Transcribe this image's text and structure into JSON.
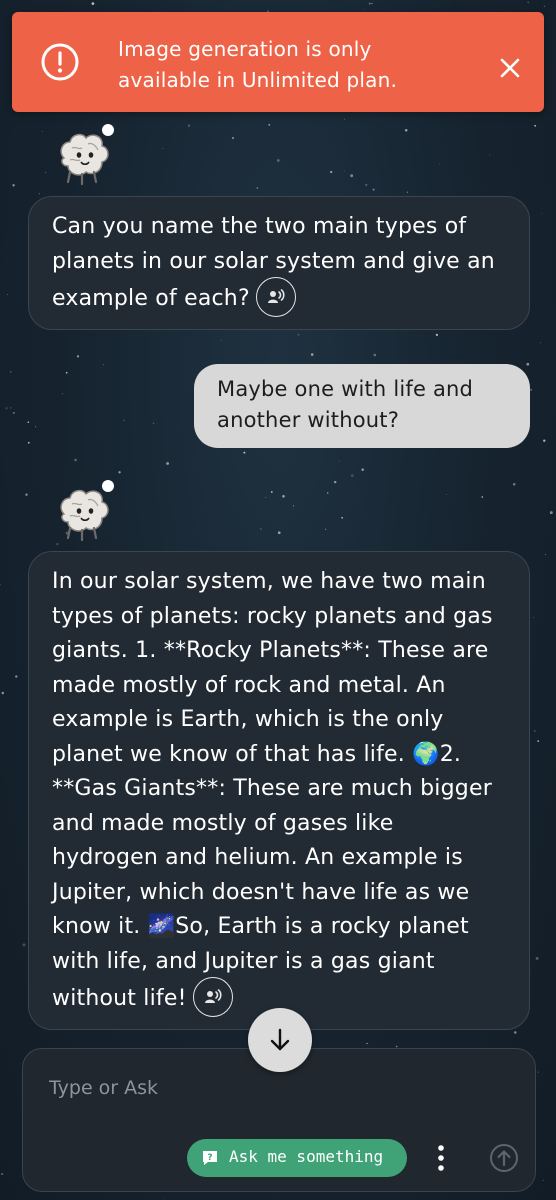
{
  "toast": {
    "icon": "alert-circle-icon",
    "line1": "Image generation is only",
    "line2": "available in Unlimited plan.",
    "close_icon": "close-icon",
    "color": "#ee6347"
  },
  "messages": [
    {
      "role": "assistant",
      "avatar": "brain-mascot-icon",
      "lines": [
        "Can you name the two main types of",
        "planets in our solar system and give an",
        "example of each?"
      ],
      "speak_icon": "speak-icon"
    },
    {
      "role": "user",
      "lines": [
        "Maybe one with life and",
        "another without?"
      ]
    },
    {
      "role": "assistant",
      "avatar": "brain-mascot-icon",
      "lines": [
        "In our solar system, we have two main",
        "types of planets: rocky planets and gas",
        "giants. 1. **Rocky Planets**: These are",
        "made mostly of rock and metal. An",
        "example is Earth, which is the only",
        "planet we know of that has life. 🌍2.",
        "**Gas Giants**: These are much bigger",
        "and made mostly of gases like",
        "hydrogen and helium. An example is",
        "Jupiter, which doesn't have life as we",
        "know it. 🌌So, Earth is a rocky planet",
        "with life, and Jupiter is a gas giant",
        "without life!"
      ],
      "speak_icon": "speak-icon"
    }
  ],
  "scroll_down_icon": "arrow-down-icon",
  "composer": {
    "placeholder": "Type or Ask",
    "ask_chip_label": "Ask me something",
    "ask_chip_icon": "question-chat-icon",
    "ask_chip_color": "#3fa377",
    "more_icon": "more-vertical-icon",
    "send_icon": "arrow-up-circle-icon"
  }
}
